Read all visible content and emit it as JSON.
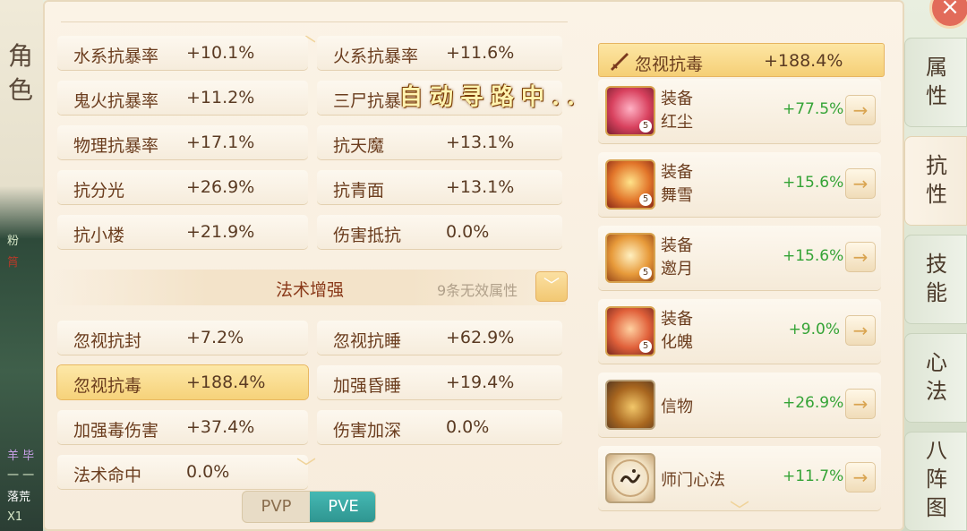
{
  "window": {
    "title": "角色"
  },
  "left_fragments": [
    "粉",
    "筲",
    "羊 毕",
    "一 一",
    "落荒",
    "X1"
  ],
  "stats_top": [
    {
      "label": "水系抗暴率",
      "value": "+10.1%"
    },
    {
      "label": "火系抗暴率",
      "value": "+11.6%"
    },
    {
      "label": "鬼火抗暴率",
      "value": "+11.2%"
    },
    {
      "label": "三尸抗暴",
      "value": ""
    },
    {
      "label": "物理抗暴率",
      "value": "+17.1%"
    },
    {
      "label": "抗天魔",
      "value": "+13.1%"
    },
    {
      "label": "抗分光",
      "value": "+26.9%"
    },
    {
      "label": "抗青面",
      "value": "+13.1%"
    },
    {
      "label": "抗小楼",
      "value": "+21.9%"
    },
    {
      "label": "伤害抵抗",
      "value": "0.0%"
    }
  ],
  "section": {
    "title": "法术增强",
    "subtitle": "9条无效属性"
  },
  "stats_bottom": [
    {
      "label": "忽视抗封",
      "value": "+7.2%"
    },
    {
      "label": "忽视抗睡",
      "value": "+62.9%"
    },
    {
      "label": "忽视抗毒",
      "value": "+188.4%"
    },
    {
      "label": "加强昏睡",
      "value": "+19.4%"
    },
    {
      "label": "加强毒伤害",
      "value": "+37.4%"
    },
    {
      "label": "伤害加深",
      "value": "0.0%"
    },
    {
      "label": "法术命中",
      "value": "0.0%"
    }
  ],
  "toggle": {
    "pvp": "PVP",
    "pve": "PVE",
    "selected": "PVE"
  },
  "floating_text": "自动寻路中..",
  "breakdown": {
    "header_label": "忽视抗毒",
    "header_value": "+188.4%",
    "items": [
      {
        "line1": "装备",
        "line2": "红尘",
        "value": "+77.5%",
        "level": "5"
      },
      {
        "line1": "装备",
        "line2": "舞雪",
        "value": "+15.6%",
        "level": "5"
      },
      {
        "line1": "装备",
        "line2": "邀月",
        "value": "+15.6%",
        "level": "5"
      },
      {
        "line1": "装备",
        "line2": "化魄",
        "value": "+9.0%",
        "level": "5"
      },
      {
        "line1": "信物",
        "line2": "",
        "value": "+26.9%",
        "level": ""
      },
      {
        "line1": "师门心法",
        "line2": "",
        "value": "+11.7%",
        "level": ""
      }
    ]
  },
  "tabs": [
    "属性",
    "抗性",
    "技能",
    "心法",
    "八阵图"
  ],
  "active_tab": "抗性",
  "icons": {
    "arrow": "→",
    "chevron_up": "︿",
    "chevron_down": "﹀",
    "close": "×"
  },
  "colors": {
    "accent_gold": "#f5cf76",
    "positive_green": "#34a335",
    "pve_teal": "#3aa7a2"
  }
}
